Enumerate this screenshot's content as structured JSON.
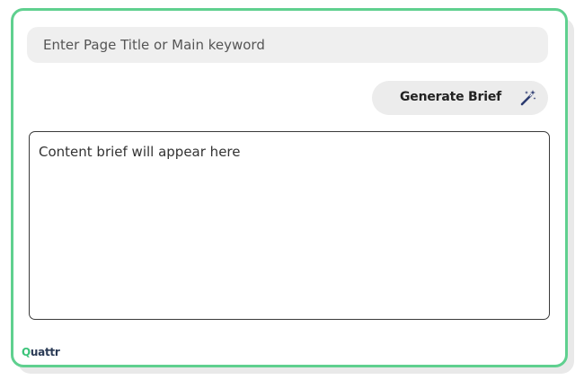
{
  "search": {
    "placeholder": "Enter Page Title or Main keyword",
    "value": ""
  },
  "generate_button": {
    "label": "Generate Brief",
    "icon": "magic-wand-icon"
  },
  "brief_output": {
    "placeholder": "Content brief will appear here"
  },
  "brand": {
    "logo_first_letter": "Q",
    "logo_rest": "uattr"
  },
  "colors": {
    "accent_border": "#5fd08f",
    "input_background": "#efefef",
    "button_background": "#ececec",
    "logo_accent": "#3cc47a",
    "logo_text": "#2a3a55",
    "wand_color": "#2b3a70"
  }
}
